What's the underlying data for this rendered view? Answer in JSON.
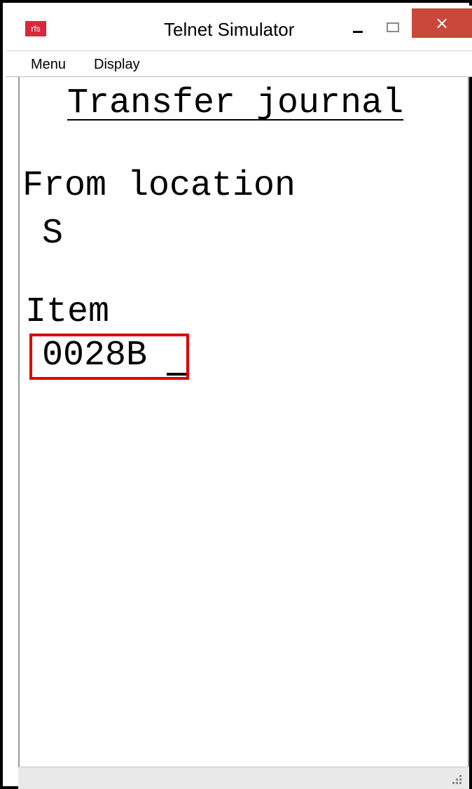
{
  "window": {
    "title": "Telnet Simulator",
    "app_icon_label": "rfs",
    "close_glyph": "×"
  },
  "menu": {
    "items": [
      "Menu",
      "Display"
    ]
  },
  "screen": {
    "title": "Transfer journal",
    "from_location_label": "From location",
    "from_location_value": "S",
    "item_label": "Item",
    "item_value": "0028B"
  },
  "colors": {
    "close_button": "#c9483b",
    "app_icon": "#d8283c",
    "highlight_border": "#e00000"
  }
}
